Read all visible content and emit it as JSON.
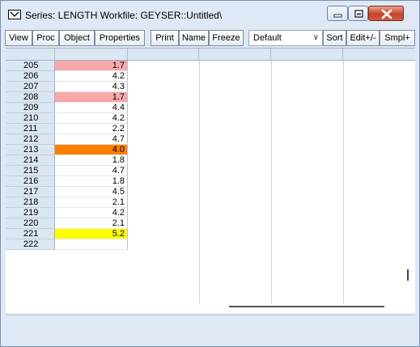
{
  "window": {
    "title": "Series: LENGTH   Workfile: GEYSER::Untitled\\"
  },
  "toolbar": {
    "buttons": [
      "View",
      "Proc",
      "Object",
      "Properties",
      "Print",
      "Name",
      "Freeze",
      "Sort",
      "Edit+/-",
      "Smpl+"
    ],
    "display_select": "Default"
  },
  "colors": {
    "highlight_pink": "#f7a8a8",
    "highlight_orange": "#ff7f00",
    "highlight_yellow": "#ffff00"
  },
  "rows": [
    {
      "obs": "205",
      "value": "1.7",
      "highlight": "pink"
    },
    {
      "obs": "206",
      "value": "4.2",
      "highlight": ""
    },
    {
      "obs": "207",
      "value": "4.3",
      "highlight": ""
    },
    {
      "obs": "208",
      "value": "1.7",
      "highlight": "pink"
    },
    {
      "obs": "209",
      "value": "4.4",
      "highlight": ""
    },
    {
      "obs": "210",
      "value": "4.2",
      "highlight": ""
    },
    {
      "obs": "211",
      "value": "2.2",
      "highlight": ""
    },
    {
      "obs": "212",
      "value": "4.7",
      "highlight": ""
    },
    {
      "obs": "213",
      "value": "4.0",
      "highlight": "orange"
    },
    {
      "obs": "214",
      "value": "1.8",
      "highlight": ""
    },
    {
      "obs": "215",
      "value": "4.7",
      "highlight": ""
    },
    {
      "obs": "216",
      "value": "1.8",
      "highlight": ""
    },
    {
      "obs": "217",
      "value": "4.5",
      "highlight": ""
    },
    {
      "obs": "218",
      "value": "2.1",
      "highlight": ""
    },
    {
      "obs": "219",
      "value": "4.2",
      "highlight": ""
    },
    {
      "obs": "220",
      "value": "2.1",
      "highlight": ""
    },
    {
      "obs": "221",
      "value": "5.2",
      "highlight": "yellow"
    },
    {
      "obs": "222",
      "value": "",
      "highlight": ""
    }
  ]
}
